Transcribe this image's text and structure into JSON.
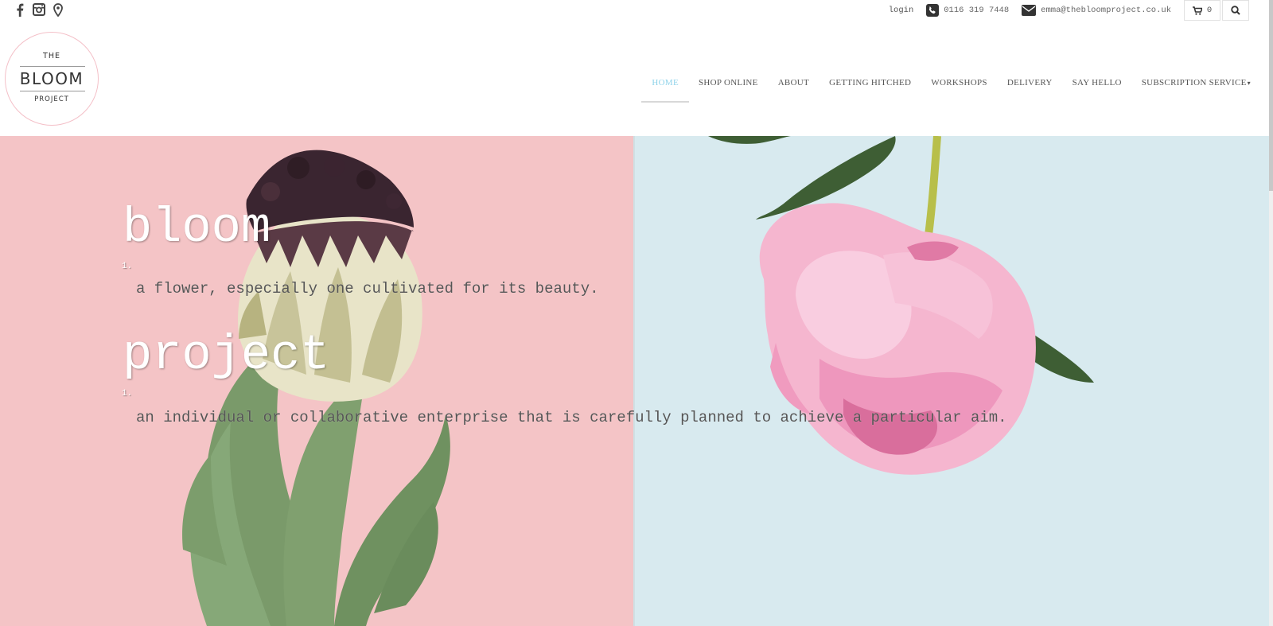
{
  "topbar": {
    "social_icons": [
      "facebook-icon",
      "instagram-icon",
      "map-pin-icon"
    ],
    "login_label": "login",
    "phone": "0116 319 7448",
    "email": "emma@thebloomproject.co.uk",
    "cart_count": "0"
  },
  "logo": {
    "line1": "THE",
    "line2": "BLOOM",
    "line3": "PROJECT"
  },
  "nav": {
    "items": [
      {
        "label": "HOME"
      },
      {
        "label": "SHOP ONLINE"
      },
      {
        "label": "ABOUT"
      },
      {
        "label": "GETTING HITCHED"
      },
      {
        "label": "WORKSHOPS"
      },
      {
        "label": "DELIVERY"
      },
      {
        "label": "SAY HELLO"
      },
      {
        "label": "SUBSCRIPTION SERVICE"
      }
    ],
    "active": "HOME",
    "caret": "▾"
  },
  "hero": {
    "term1": "bloom",
    "num1": "1.",
    "def1": "a flower, especially one cultivated for its beauty.",
    "term2": "project",
    "num2": "1.",
    "def2": "an individual or collaborative enterprise that is carefully planned to achieve a particular aim."
  },
  "colors": {
    "accent_active": "#8fd3ea",
    "hero_pink": "#f4c4c6",
    "hero_blue": "#d8eaef",
    "logo_ring": "#f4c0c8"
  }
}
